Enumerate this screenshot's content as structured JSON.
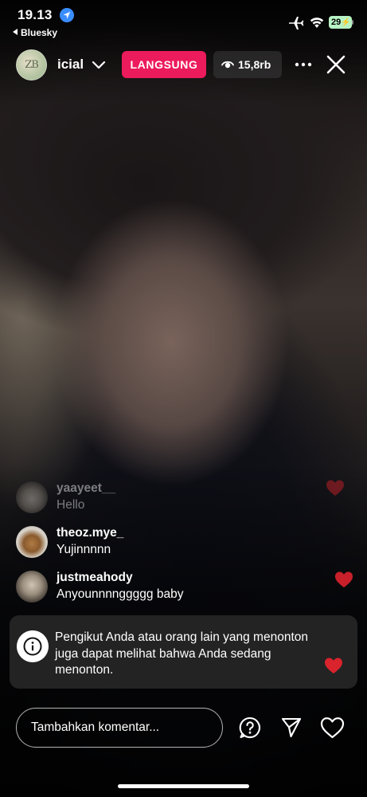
{
  "status_bar": {
    "time": "19.13",
    "back_app": "Bluesky",
    "battery": "29"
  },
  "header": {
    "host_avatar_text": "ZB",
    "host_name": "icial",
    "live_label": "LANGSUNG",
    "viewer_count": "15,8rb"
  },
  "comments": [
    {
      "username": "yaayeet__",
      "text": "Hello",
      "faded": true
    },
    {
      "username": "theoz.mye_",
      "text": "Yujinnnnn",
      "faded": false
    },
    {
      "username": "justmeahody",
      "text": "Anyounnnnggggg baby",
      "faded": false
    }
  ],
  "notice": {
    "text": "Pengikut Anda atau orang lain yang menonton juga dapat melihat bahwa Anda sedang menonton."
  },
  "composer": {
    "placeholder": "Tambahkan komentar..."
  },
  "colors": {
    "live_badge": "#ec1b5c",
    "heart": "#d9232d",
    "notice_bg": "#262626"
  },
  "icons": [
    "location-arrow-icon",
    "airplane-icon",
    "wifi-icon",
    "eye-icon",
    "more-icon",
    "close-icon",
    "info-icon",
    "question-icon",
    "send-icon",
    "heart-icon"
  ]
}
